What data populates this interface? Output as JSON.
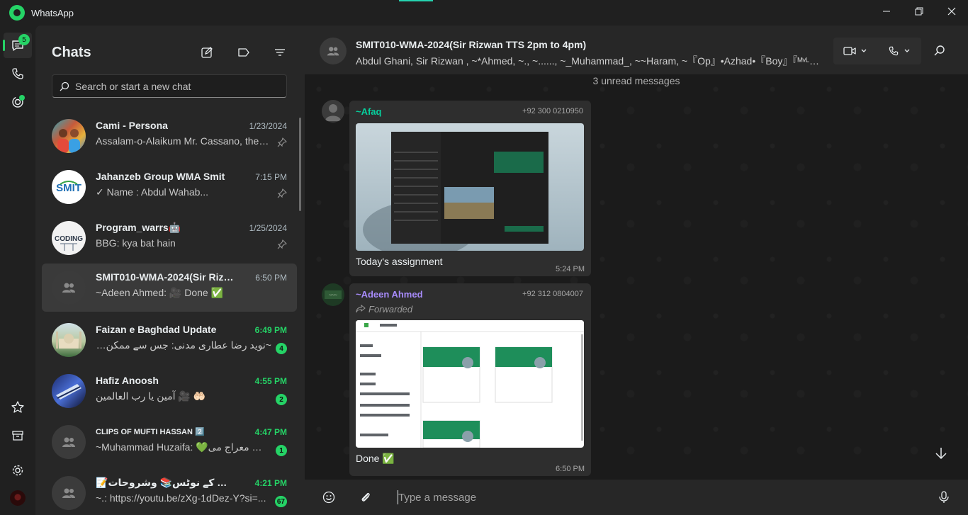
{
  "app": {
    "title": "WhatsApp"
  },
  "colors": {
    "accent": "#25d366",
    "bubble": "#2e2e2e",
    "panel": "#272727",
    "background": "#202020"
  },
  "rail": {
    "chats_badge": "5",
    "items": [
      "chats-icon",
      "calls-icon",
      "status-icon",
      "starred-icon",
      "archive-icon",
      "settings-icon",
      "profile-avatar"
    ]
  },
  "chatlist": {
    "title": "Chats",
    "search_placeholder": "Search or start a new chat",
    "items": [
      {
        "name": "Cami - Persona",
        "preview": "Assalam-o-Alaikum Mr. Cassano, the f...",
        "time": "1/23/2024",
        "pinned": true,
        "unread": ""
      },
      {
        "name": "Jahanzeb Group WMA Smit",
        "preview": "✓ Name : Abdul Wahab...",
        "time": "7:15 PM",
        "pinned": true,
        "unread": ""
      },
      {
        "name": "Program_warrs🤖",
        "preview": "BBG: kya bat hain",
        "time": "1/25/2024",
        "pinned": true,
        "unread": ""
      },
      {
        "name": "SMIT010-WMA-2024(Sir Rizwa...",
        "preview": "~Adeen Ahmed: 🎥 Done ✅",
        "time": "6:50 PM",
        "pinned": false,
        "unread": ""
      },
      {
        "name": "Faizan e Baghdad Update",
        "preview": "~نوید رضا عطاری مدنی: جس سے ممکن ہ...",
        "time": "6:49 PM",
        "pinned": false,
        "unread": "4"
      },
      {
        "name": "Hafiz Anoosh",
        "preview": "آمین یا رب العالمین 🎥 🤲🏻",
        "time": "4:55 PM",
        "pinned": false,
        "unread": "2"
      },
      {
        "name": "CLIPS OF MUFTI HASSAN 2️⃣",
        "preview": "~Muhammad Huzaifa: 💚آیتِ معراج می...",
        "time": "4:47 PM",
        "pinned": false,
        "unread": "1"
      },
      {
        "name": "📝کنزالمدارس کے نوٹس📚 وشروحات",
        "preview": "~.: https://youtu.be/zXg-1dDez-Y?si=...",
        "time": "4:21 PM",
        "pinned": false,
        "unread": "67"
      }
    ]
  },
  "conversation": {
    "title": "SMIT010-WMA-2024(Sir Rizwan TTS 2pm to 4pm)",
    "members": "Abdul Ghani, Sir Rizwan , ~*Ahmed, ~., ~......, ~_Muhammad_, ~~Haram, ~『Op』•Azhad•『Boy』『ᴹᵛᴸ』•VEN,...",
    "unread_banner": "3 unread messages",
    "messages": [
      {
        "sender": "~Afaq",
        "phone": "+92 300 0210950",
        "forwarded": "",
        "caption": "Today's assignment",
        "time": "5:24 PM",
        "sender_color": "#06cf9c"
      },
      {
        "sender": "~Adeen Ahmed",
        "phone": "+92 312 0804007",
        "forwarded": "Forwarded",
        "caption": "Done ✅",
        "time": "6:50 PM",
        "sender_color": "#a78bfa"
      }
    ],
    "composer_placeholder": "Type a message"
  },
  "window_controls": {
    "minimize": "—",
    "maximize": "❐",
    "close": "✕"
  }
}
